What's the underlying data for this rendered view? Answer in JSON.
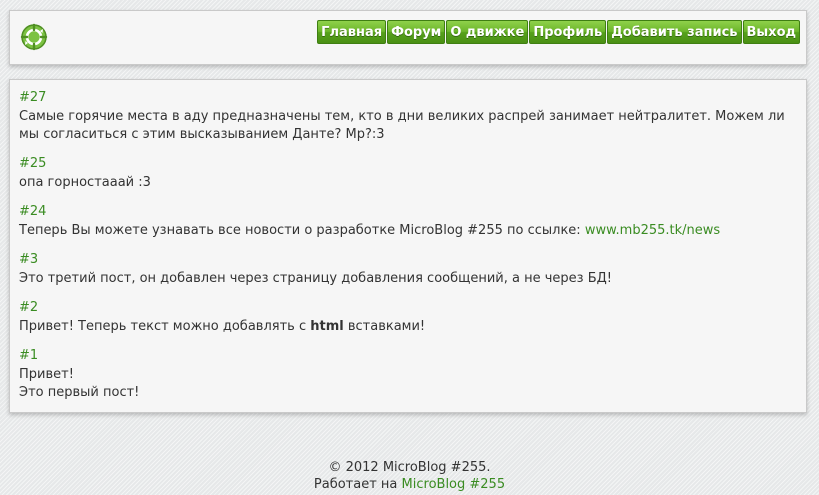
{
  "nav": {
    "home": "Главная",
    "forum": "Форум",
    "about": "О движке",
    "profile": "Профиль",
    "add_post": "Добавить запись",
    "logout": "Выход"
  },
  "posts": [
    {
      "id": "#27",
      "text": "Самые горячие места в аду предназначены тем, кто в дни великих распрей занимает нейтралитет. Можем ли мы согласиться с этим высказыванием Данте? Мр?:3"
    },
    {
      "id": "#25",
      "text": "опа горностааай :3"
    },
    {
      "id": "#24",
      "text_before": "Теперь Вы можете узнавать все новости о разработке MicroBlog #255 по ссылке: ",
      "link": "www.mb255.tk/news"
    },
    {
      "id": "#3",
      "text": "Это третий пост, он добавлен через страницу добавления сообщений, а не через БД!"
    },
    {
      "id": "#2",
      "text_before": "Привет! Теперь текст можно добавлять с ",
      "bold": "html",
      "text_after": " вставками!"
    },
    {
      "id": "#1",
      "line1": "Привет!",
      "line2": "Это первый пост!"
    }
  ],
  "footer": {
    "copyright": "© 2012 MicroBlog #255.",
    "powered_prefix": "Работает на ",
    "powered_link": "MicroBlog #255"
  },
  "colors": {
    "accent_green": "#3a8c22",
    "button_green": "#6cb62b",
    "panel_bg": "#f6f6f6"
  },
  "icons": {
    "logo": "recycle-arrows-logo-icon"
  }
}
